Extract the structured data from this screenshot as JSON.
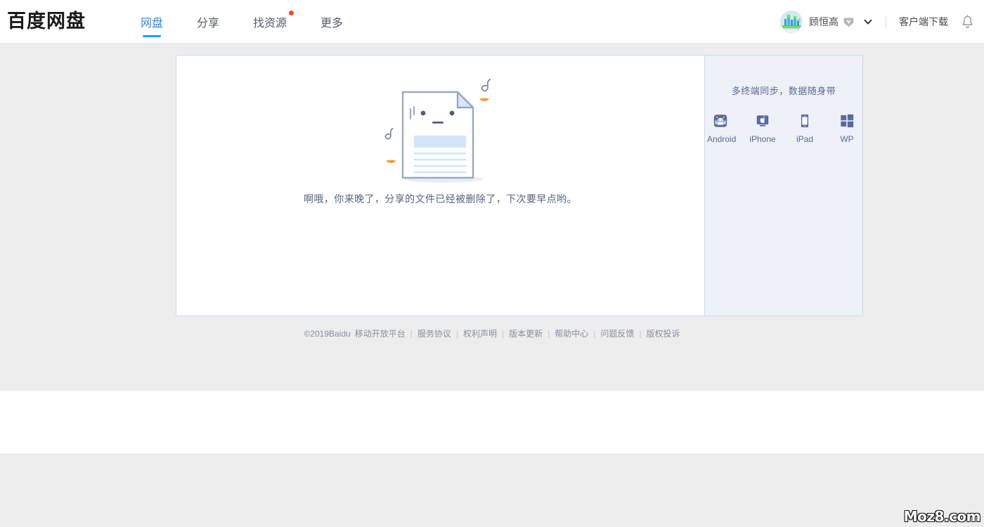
{
  "header": {
    "logo": "百度网盘",
    "nav": [
      {
        "label": "网盘",
        "active": true,
        "dot": false
      },
      {
        "label": "分享",
        "active": false,
        "dot": false
      },
      {
        "label": "找资源",
        "active": false,
        "dot": true
      },
      {
        "label": "更多",
        "active": false,
        "dot": false
      }
    ],
    "username": "顾恒高",
    "vip_badge": "vip-diamond-icon",
    "dropdown_icon": "chevron-down-icon",
    "client_download": "客户端下载",
    "notification_icon": "bell-icon",
    "avatar_icon": "user-avatar"
  },
  "main": {
    "illustration": "deleted-file-document-icon",
    "message": "啊哦，你来晚了，分享的文件已经被删除了，下次要早点哟。"
  },
  "sidebar": {
    "title": "多终端同步，数据随身带",
    "apps": [
      {
        "label": "Android",
        "icon": "android-icon"
      },
      {
        "label": "iPhone",
        "icon": "iphone-icon"
      },
      {
        "label": "iPad",
        "icon": "ipad-icon"
      },
      {
        "label": "WP",
        "icon": "windows-phone-icon"
      }
    ]
  },
  "footer": {
    "copyright": "©2019Baidu",
    "links": [
      "移动开放平台",
      "服务协议",
      "权利声明",
      "版本更新",
      "帮助中心",
      "问题反馈",
      "版权投诉"
    ]
  },
  "watermark": "Moz8.com",
  "colors": {
    "page_bg": "#ededee",
    "accent_blue": "#2e8ce6",
    "underline_blue": "#19a5f7",
    "badge_red": "#f5492f",
    "panel_border": "#cdd9ee",
    "side_bg": "#eef1f7",
    "icon_slate": "#5b6a9e",
    "text_muted": "#8a8f99",
    "message_text": "#56647d"
  }
}
